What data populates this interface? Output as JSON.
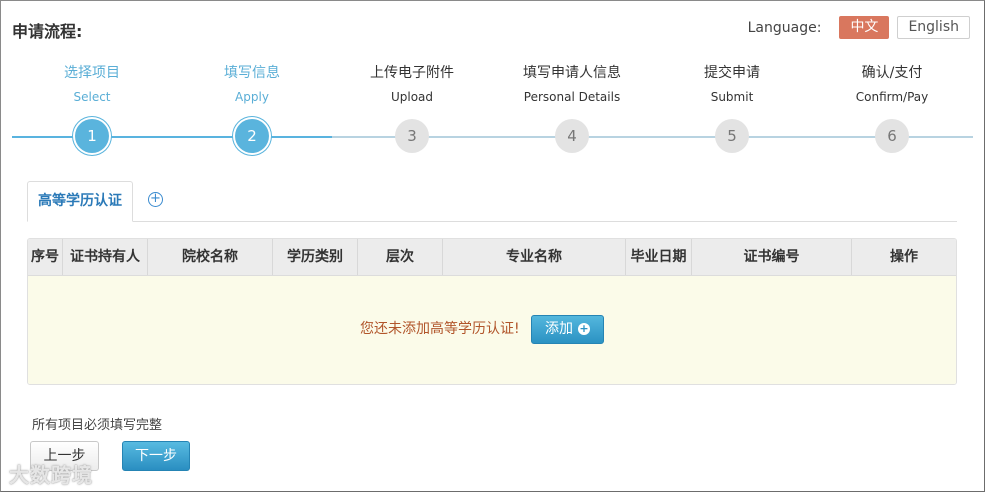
{
  "header": {
    "title": "申请流程:"
  },
  "language": {
    "label": "Language:",
    "options": [
      "中文",
      "English"
    ],
    "selected": "中文"
  },
  "steps": [
    {
      "zh": "选择项目",
      "en": "Select",
      "num": "1",
      "status": "done"
    },
    {
      "zh": "填写信息",
      "en": "Apply",
      "num": "2",
      "status": "current"
    },
    {
      "zh": "上传电子附件",
      "en": "Upload",
      "num": "3",
      "status": "todo"
    },
    {
      "zh": "填写申请人信息",
      "en": "Personal Details",
      "num": "4",
      "status": "todo"
    },
    {
      "zh": "提交申请",
      "en": "Submit",
      "num": "5",
      "status": "todo"
    },
    {
      "zh": "确认/支付",
      "en": "Confirm/Pay",
      "num": "6",
      "status": "todo"
    }
  ],
  "tabs": {
    "active_label": "高等学历认证",
    "add_icon": "plus-circle-icon"
  },
  "table": {
    "columns": [
      "序号",
      "证书持有人",
      "院校名称",
      "学历类别",
      "层次",
      "专业名称",
      "毕业日期",
      "证书编号",
      "操作"
    ],
    "empty_message": "您还未添加高等学历认证!",
    "add_label": "添加"
  },
  "footer": {
    "note": "所有项目必须填写完整",
    "prev_label": "上一步",
    "next_label": "下一步"
  },
  "watermark": "大数跨境",
  "colors": {
    "accent": "#5ab4dd",
    "lang_active": "#d9775e",
    "empty_bg": "#fbfbe9",
    "empty_text": "#b1552a"
  }
}
